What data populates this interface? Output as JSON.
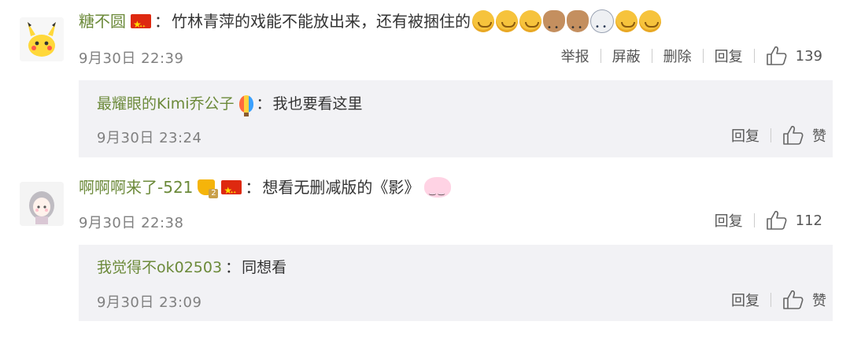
{
  "comments": [
    {
      "username": "糖不圆",
      "text": "竹林青萍的戏能不能放出来，还有被捆住的",
      "time": "9月30日 22:39",
      "actions": [
        "举报",
        "屏蔽",
        "删除",
        "回复"
      ],
      "like_count": "139",
      "reply": {
        "username": "最耀眼的Kimi乔公子",
        "text": "我也要看这里",
        "time": "9月30日 23:24",
        "reply_label": "回复",
        "like_label": "赞"
      }
    },
    {
      "username": "啊啊啊来了-521",
      "text": "想看无删减版的《影》",
      "time": "9月30日 22:38",
      "reply_label": "回复",
      "like_count": "112",
      "reply": {
        "username": "我觉得不ok02503",
        "text": "同想看",
        "time": "9月30日 23:09",
        "reply_label": "回复",
        "like_label": "赞"
      }
    }
  ],
  "colon": "：",
  "icons": [
    "china-flag-icon",
    "thumbs-up-icon",
    "balloon-icon",
    "crown-icon",
    "emoji-icon",
    "rabbit-icon"
  ]
}
